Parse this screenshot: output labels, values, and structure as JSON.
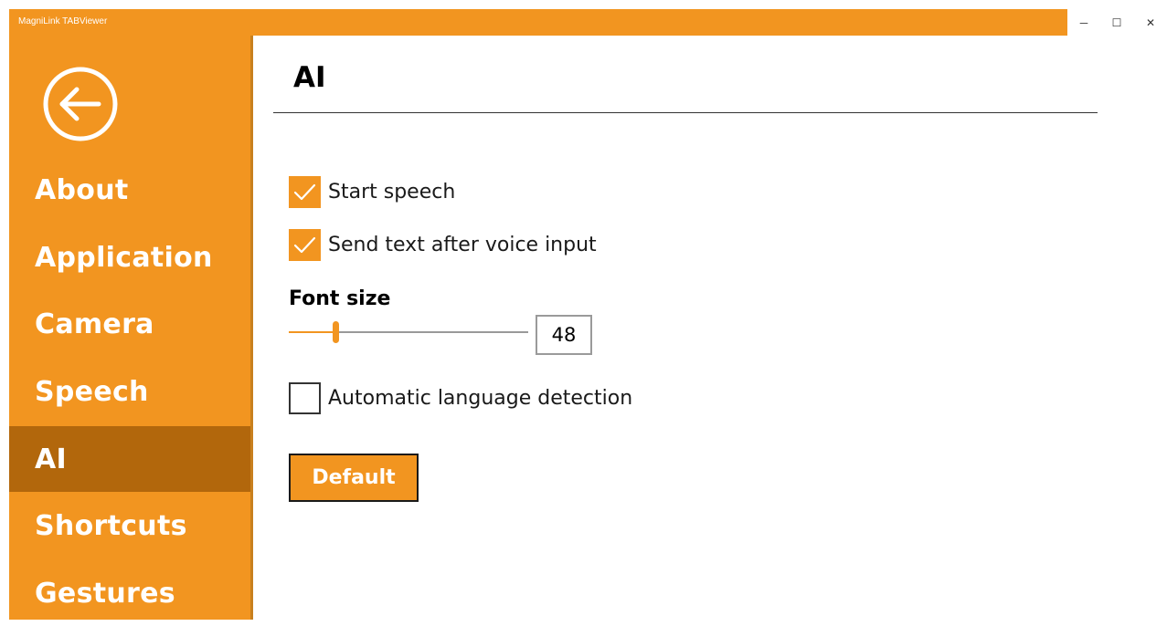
{
  "app": {
    "title": "MagniLink TABViewer"
  },
  "window_controls": {
    "minimize": "─",
    "maximize": "☐",
    "close": "✕"
  },
  "icons": {
    "back": "back-arrow-icon",
    "check": "checkmark-icon"
  },
  "colors": {
    "accent": "#f29520",
    "selected": "#b2670c",
    "text": "#000000"
  },
  "sidebar": {
    "items": [
      {
        "label": "About",
        "selected": false
      },
      {
        "label": "Application",
        "selected": false
      },
      {
        "label": "Camera",
        "selected": false
      },
      {
        "label": "Speech",
        "selected": false
      },
      {
        "label": "AI",
        "selected": true
      },
      {
        "label": "Shortcuts",
        "selected": false
      },
      {
        "label": "Gestures",
        "selected": false
      }
    ]
  },
  "page": {
    "title": "AI"
  },
  "settings": {
    "start_speech": {
      "label": "Start speech",
      "checked": true
    },
    "send_text": {
      "label": "Send text after voice input",
      "checked": true
    },
    "font_size": {
      "label": "Font size",
      "value": "48",
      "slider_fraction": 0.19
    },
    "auto_language": {
      "label": "Automatic language detection",
      "checked": false
    }
  },
  "buttons": {
    "default_label": "Default"
  }
}
